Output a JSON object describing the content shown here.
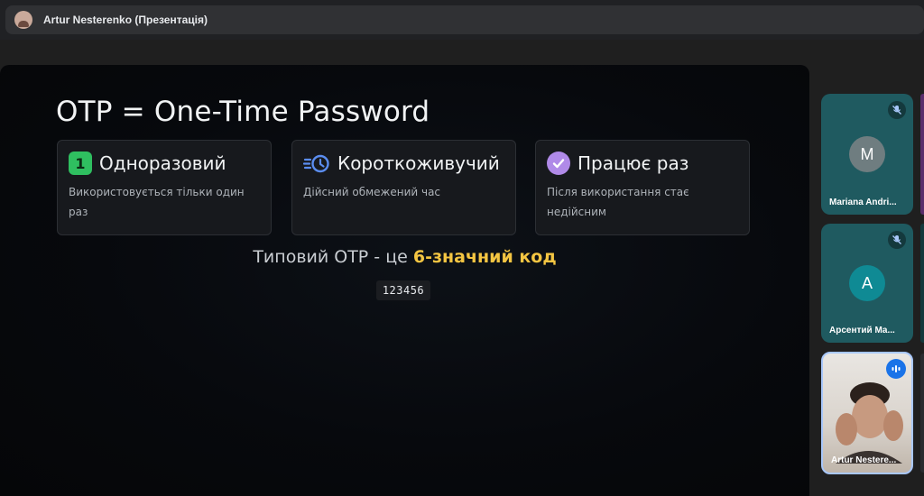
{
  "meeting": {
    "presenter_title": "Artur Nesterenko (Презентація)"
  },
  "slide": {
    "title": "OTP = One-Time Password",
    "cards": [
      {
        "icon": "number-one-icon",
        "title": "Одноразовий",
        "desc_lines": [
          "Використовується тільки один раз"
        ]
      },
      {
        "icon": "clock-history-icon",
        "title": "Короткоживучий",
        "desc_lines": [
          "Дійсний обмежений час"
        ]
      },
      {
        "icon": "check-circle-icon",
        "title": "Працює раз",
        "desc_lines": [
          "Після використання стає",
          "недійсним"
        ]
      }
    ],
    "typical_prefix": "Типовий OTP - це ",
    "typical_highlight": "6-значний код",
    "example_code": "123456",
    "colors": {
      "highlight": "#f4c542",
      "card_one_icon": "#2fbf60",
      "card_check_icon": "#b08ae8",
      "card_clock_icon": "#5b8def"
    }
  },
  "participants": [
    {
      "initial": "M",
      "name": "Mariana Andri...",
      "muted": true,
      "avatar_color": "#6f7d80"
    },
    {
      "initial": "A",
      "name": "Арсентий Ма...",
      "muted": true,
      "avatar_color": "#0f8a94"
    },
    {
      "name": "Artur Nestere...",
      "speaking": true
    }
  ],
  "one_glyph": "1"
}
